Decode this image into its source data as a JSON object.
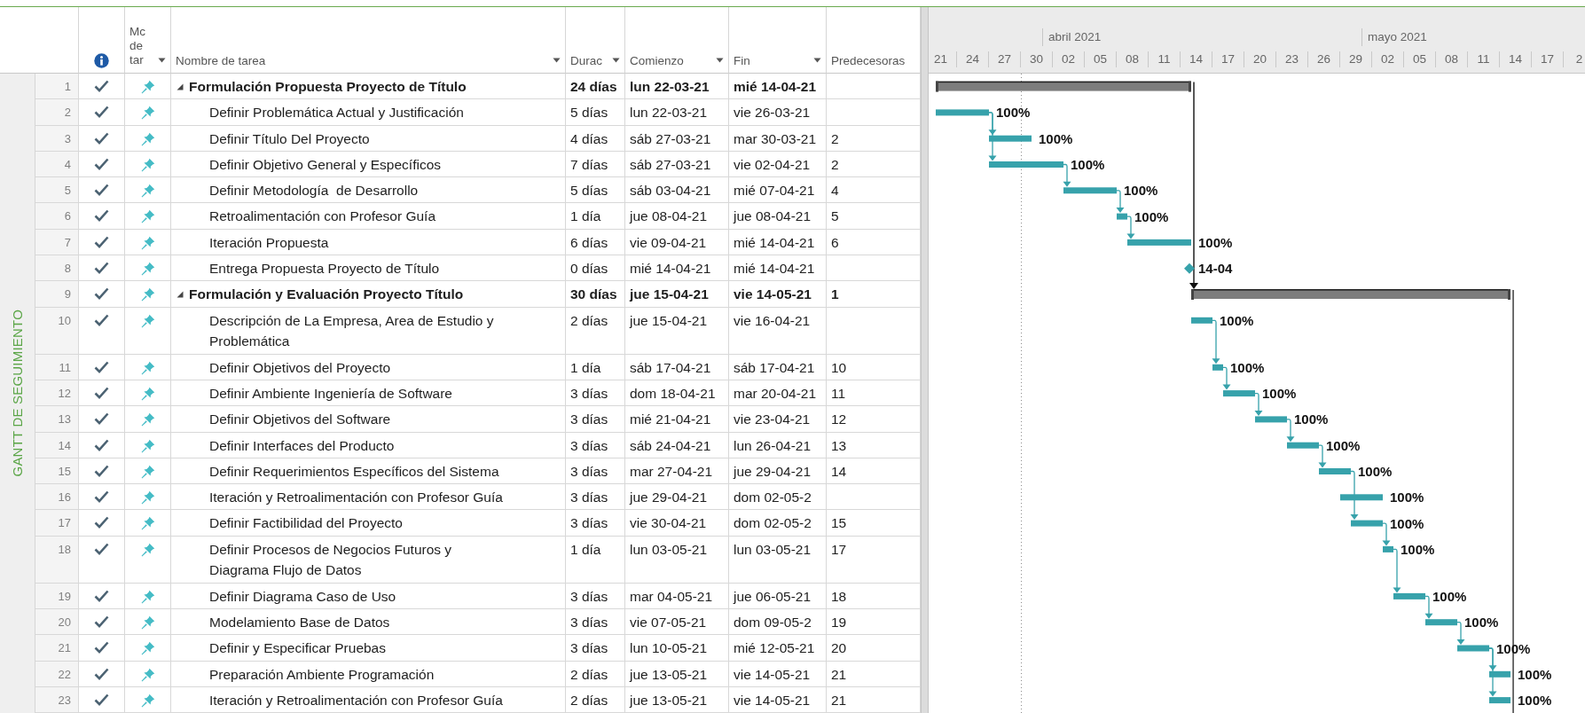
{
  "view_label": "GANTT DE SEGUIMIENTO",
  "columns": [
    {
      "label": "Mc de tar",
      "menu": true
    },
    {
      "label": "Nombre de tarea",
      "menu": true
    },
    {
      "label": "Durac",
      "menu": true
    },
    {
      "label": "Comienzo",
      "menu": true
    },
    {
      "label": "Fin",
      "menu": true
    },
    {
      "label": "Predecesoras",
      "menu": false
    }
  ],
  "timescale": {
    "months": [
      "abril 2021",
      "mayo 2021"
    ],
    "days": [
      "21",
      "24",
      "27",
      "30",
      "02",
      "05",
      "08",
      "11",
      "14",
      "17",
      "20",
      "23",
      "26",
      "29",
      "02",
      "05",
      "08",
      "11",
      "14",
      "17",
      "2"
    ]
  },
  "tasks": [
    {
      "id": "1",
      "kind": "summary",
      "expanded": true,
      "complete": true,
      "manual": true,
      "name": "Formulación Propuesta Proyecto de Título",
      "duration": "24 días",
      "start": "lun 22-03-21",
      "finish": "mié 14-04-21",
      "children": [
        {
          "id": "2",
          "kind": "task",
          "complete": true,
          "manual": true,
          "name": "Definir Problemática Actual y Justificación",
          "duration": "5 días",
          "start": "lun 22-03-21",
          "finish": "vie 26-03-21",
          "bar_label": "100%"
        },
        {
          "id": "3",
          "kind": "task",
          "complete": true,
          "manual": true,
          "name": "Definir Título Del Proyecto",
          "duration": "4 días",
          "start": "sáb 27-03-21",
          "finish": "mar 30-03-21",
          "predecessors": "2",
          "bar_label": "100%"
        },
        {
          "id": "4",
          "kind": "task",
          "complete": true,
          "manual": true,
          "name": "Definir Objetivo General y Específicos",
          "duration": "7 días",
          "start": "sáb 27-03-21",
          "finish": "vie 02-04-21",
          "predecessors": "2",
          "bar_label": "100%"
        },
        {
          "id": "5",
          "kind": "task",
          "complete": true,
          "manual": true,
          "name": "Definir Metodología  de Desarrollo",
          "duration": "5 días",
          "start": "sáb 03-04-21",
          "finish": "mié 07-04-21",
          "predecessors": "4",
          "bar_label": "100%"
        },
        {
          "id": "6",
          "kind": "task",
          "complete": true,
          "manual": true,
          "name": "Retroalimentación con Profesor Guía",
          "duration": "1 día",
          "start": "jue 08-04-21",
          "finish": "jue 08-04-21",
          "predecessors": "5",
          "bar_label": "100%"
        },
        {
          "id": "7",
          "kind": "task",
          "complete": true,
          "manual": true,
          "name": "Iteración Propuesta",
          "duration": "6 días",
          "start": "vie 09-04-21",
          "finish": "mié 14-04-21",
          "predecessors": "6",
          "bar_label": "100%"
        },
        {
          "id": "8",
          "kind": "milestone",
          "complete": true,
          "manual": true,
          "name": "Entrega Propuesta Proyecto de Título",
          "duration": "0 días",
          "start": "mié 14-04-21",
          "finish": "mié 14-04-21",
          "bar_label": "14-04"
        }
      ]
    },
    {
      "id": "9",
      "kind": "summary",
      "expanded": true,
      "complete": true,
      "manual": true,
      "name": "Formulación y Evaluación Proyecto Título",
      "duration": "30 días",
      "start": "jue 15-04-21",
      "finish": "vie 14-05-21",
      "predecessors": "1",
      "link_below": true,
      "children": [
        {
          "id": "10",
          "kind": "task",
          "complete": true,
          "manual": true,
          "name": "Descripción de La Empresa, Area de Estudio y\nProblemática",
          "duration": "2 días",
          "start": "jue 15-04-21",
          "finish": "vie 16-04-21",
          "bar_label": "100%"
        },
        {
          "id": "11",
          "kind": "task",
          "complete": true,
          "manual": true,
          "name": "Definir Objetivos del Proyecto",
          "duration": "1 día",
          "start": "sáb 17-04-21",
          "finish": "sáb 17-04-21",
          "predecessors": "10",
          "bar_label": "100%"
        },
        {
          "id": "12",
          "kind": "task",
          "complete": true,
          "manual": true,
          "name": "Definir Ambiente Ingeniería de Software",
          "duration": "3 días",
          "start": "dom 18-04-21",
          "finish": "mar 20-04-21",
          "predecessors": "11",
          "bar_label": "100%"
        },
        {
          "id": "13",
          "kind": "task",
          "complete": true,
          "manual": true,
          "name": "Definir Objetivos del Software",
          "duration": "3 días",
          "start": "mié 21-04-21",
          "finish": "vie 23-04-21",
          "predecessors": "12",
          "bar_label": "100%"
        },
        {
          "id": "14",
          "kind": "task",
          "complete": true,
          "manual": true,
          "name": "Definir Interfaces del Producto",
          "duration": "3 días",
          "start": "sáb 24-04-21",
          "finish": "lun 26-04-21",
          "predecessors": "13",
          "bar_label": "100%"
        },
        {
          "id": "15",
          "kind": "task",
          "complete": true,
          "manual": true,
          "name": "Definir Requerimientos Específicos del Sistema",
          "duration": "3 días",
          "start": "mar 27-04-21",
          "finish": "jue 29-04-21",
          "predecessors": "14",
          "bar_label": "100%"
        },
        {
          "id": "16",
          "kind": "task",
          "complete": true,
          "manual": true,
          "name": "Iteración y Retroalimentación con Profesor Guía",
          "duration": "3 días",
          "start": "jue 29-04-21",
          "finish": "dom 02-05-2",
          "bar_label": "100%"
        },
        {
          "id": "17",
          "kind": "task",
          "complete": true,
          "manual": true,
          "name": "Definir Factibilidad del Proyecto",
          "duration": "3 días",
          "start": "vie 30-04-21",
          "finish": "dom 02-05-2",
          "predecessors": "15",
          "bar_label": "100%"
        },
        {
          "id": "18",
          "kind": "task",
          "complete": true,
          "manual": true,
          "name": "Definir Procesos de Negocios Futuros y\nDiagrama Flujo de Datos",
          "duration": "1 día",
          "start": "lun 03-05-21",
          "finish": "lun 03-05-21",
          "predecessors": "17",
          "bar_label": "100%"
        },
        {
          "id": "19",
          "kind": "task",
          "complete": true,
          "manual": true,
          "name": "Definir Diagrama Caso de Uso",
          "duration": "3 días",
          "start": "mar 04-05-21",
          "finish": "jue 06-05-21",
          "predecessors": "18",
          "bar_label": "100%"
        },
        {
          "id": "20",
          "kind": "task",
          "complete": true,
          "manual": true,
          "name": "Modelamiento Base de Datos",
          "duration": "3 días",
          "start": "vie 07-05-21",
          "finish": "dom 09-05-2",
          "predecessors": "19",
          "bar_label": "100%"
        },
        {
          "id": "21",
          "kind": "task",
          "complete": true,
          "manual": true,
          "name": "Definir y Especificar Pruebas",
          "duration": "3 días",
          "start": "lun 10-05-21",
          "finish": "mié 12-05-21",
          "predecessors": "20",
          "bar_label": "100%"
        },
        {
          "id": "22",
          "kind": "task",
          "complete": true,
          "manual": true,
          "name": "Preparación Ambiente Programación",
          "duration": "2 días",
          "start": "jue 13-05-21",
          "finish": "vie 14-05-21",
          "predecessors": "21",
          "bar_label": "100%"
        },
        {
          "id": "23",
          "kind": "task",
          "complete": true,
          "manual": true,
          "name": "Iteración y Retroalimentación con Profesor Guía",
          "duration": "2 días",
          "start": "jue 13-05-21",
          "finish": "vie 14-05-21",
          "predecessors": "21",
          "bar_label": "100%"
        }
      ]
    }
  ]
}
